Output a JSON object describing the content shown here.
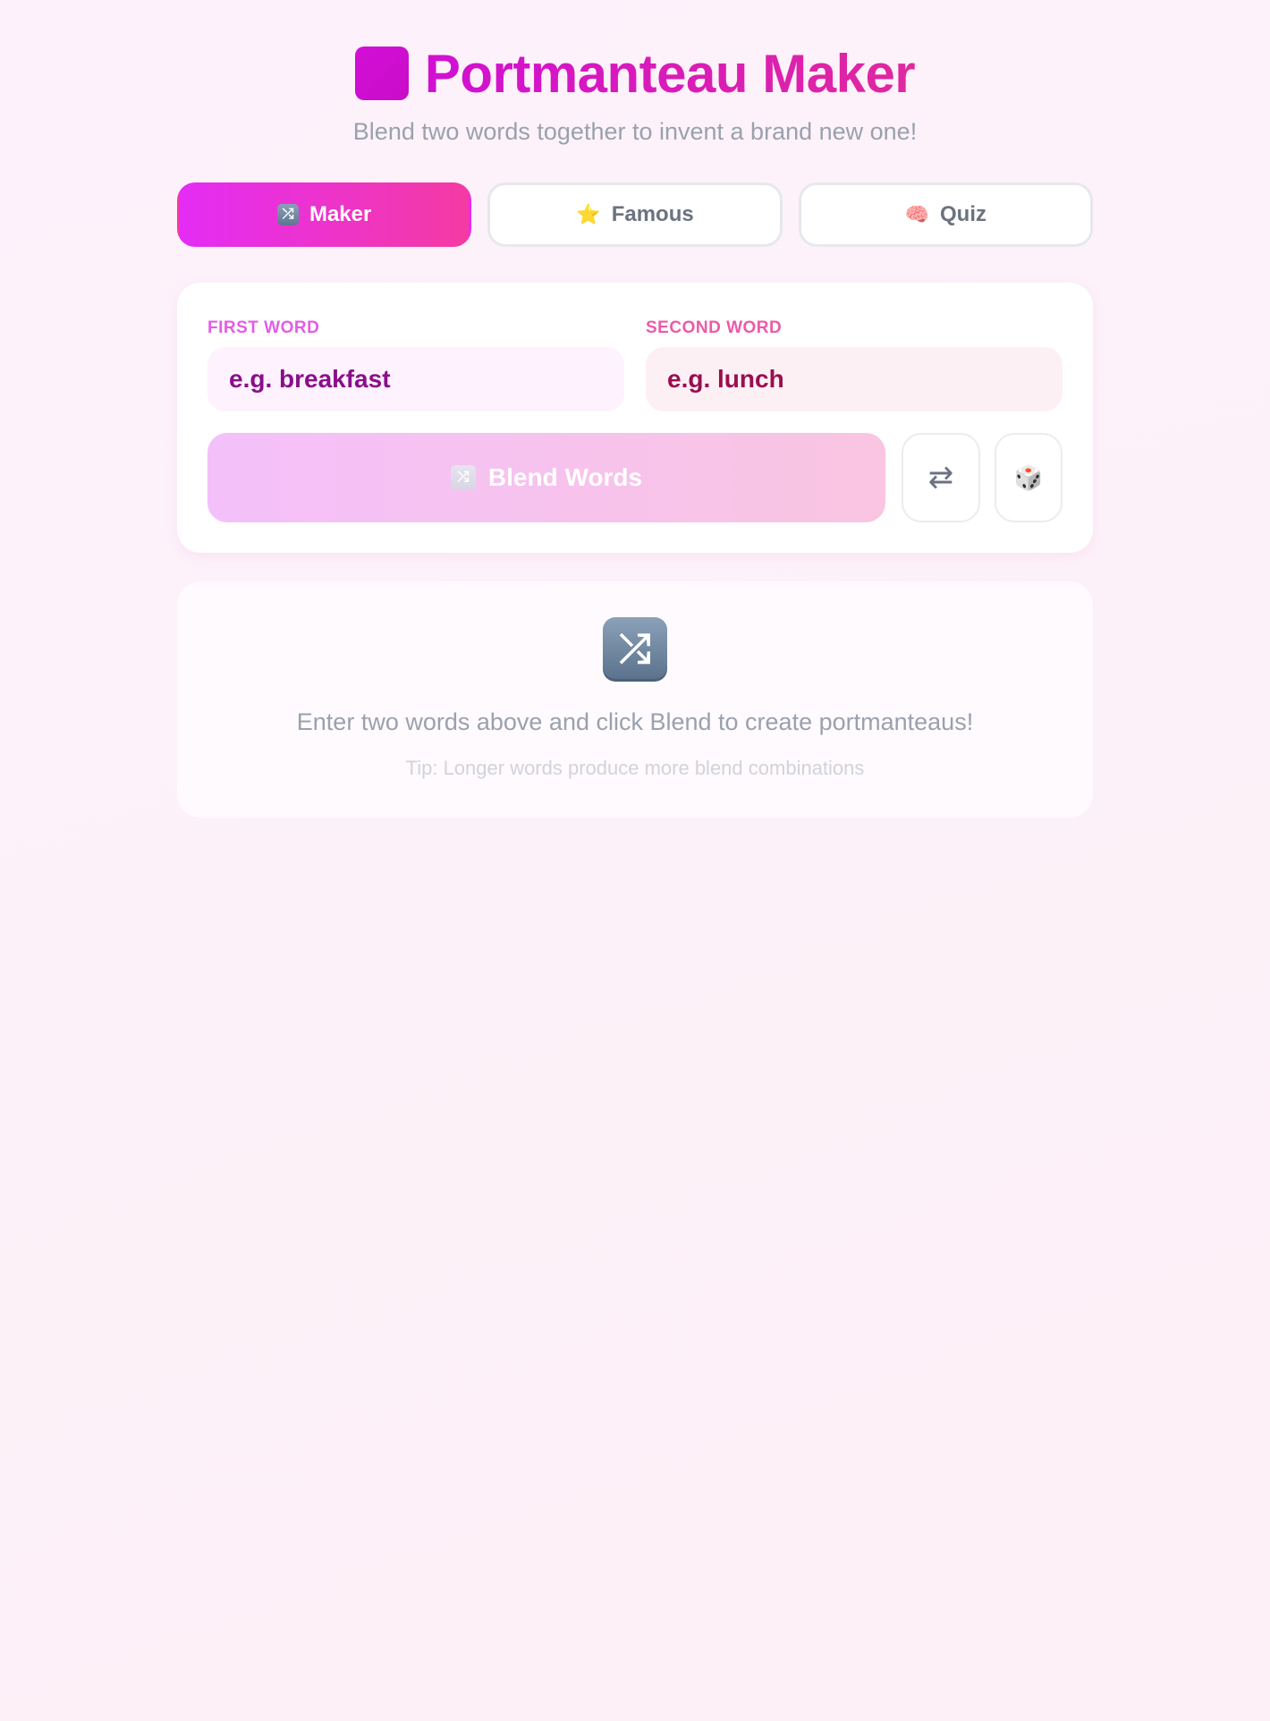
{
  "header": {
    "title": "Portmanteau Maker",
    "subtitle": "Blend two words together to invent a brand new one!"
  },
  "tabs": [
    {
      "icon": "shuffle-icon",
      "glyph": "⤮",
      "label": "Maker",
      "active": true
    },
    {
      "icon": "star-icon",
      "glyph": "⭐",
      "label": "Famous",
      "active": false
    },
    {
      "icon": "brain-icon",
      "glyph": "🧠",
      "label": "Quiz",
      "active": false
    }
  ],
  "form": {
    "first_label": "FIRST WORD",
    "first_placeholder": "e.g. breakfast",
    "first_value": "",
    "second_label": "SECOND WORD",
    "second_placeholder": "e.g. lunch",
    "second_value": "",
    "blend_label": "Blend Words",
    "swap_glyph": "⇄",
    "random_glyph": "🎲"
  },
  "empty_state": {
    "icon": "shuffle-icon",
    "glyph": "⤮",
    "message": "Enter two words above and click Blend to create portmanteaus!",
    "tip": "Tip: Longer words produce more blend combinations"
  },
  "colors": {
    "accent_magenta": "#d20fd6",
    "accent_pink": "#f53aa2",
    "label_first": "#e45ce6",
    "label_second": "#ec5aa8"
  }
}
